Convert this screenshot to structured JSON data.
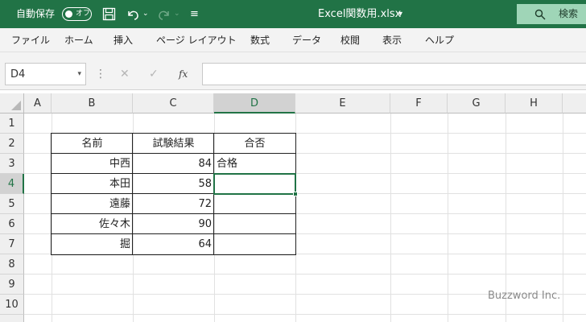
{
  "titlebar": {
    "autosave_label": "自動保存",
    "autosave_toggle": "オフ",
    "filename": "Excel関数用.xlsx",
    "filename_caret": "▾",
    "search_label": "検索",
    "customize": "≡"
  },
  "ribbon": {
    "tabs": [
      "ファイル",
      "ホーム",
      "挿入",
      "ページ レイアウト",
      "数式",
      "データ",
      "校閲",
      "表示",
      "ヘルプ"
    ]
  },
  "formula_bar": {
    "name_box": "D4",
    "name_caret": "▾",
    "dots": "⋮",
    "cancel": "✕",
    "enter": "✓",
    "fx": "fx",
    "formula": ""
  },
  "columns": [
    "A",
    "B",
    "C",
    "D",
    "E",
    "F",
    "G",
    "H"
  ],
  "selected_column": "D",
  "rows": [
    "1",
    "2",
    "3",
    "4",
    "5",
    "6",
    "7",
    "8",
    "9",
    "10"
  ],
  "selected_row": "4",
  "table": {
    "headers": [
      "名前",
      "試験結果",
      "合否"
    ],
    "rows": [
      {
        "name": "中西",
        "score": "84",
        "result": "合格"
      },
      {
        "name": "本田",
        "score": "58",
        "result": ""
      },
      {
        "name": "遠藤",
        "score": "72",
        "result": ""
      },
      {
        "name": "佐々木",
        "score": "90",
        "result": ""
      },
      {
        "name": "掘",
        "score": "64",
        "result": ""
      }
    ]
  },
  "watermark": "Buzzword Inc.",
  "colors": {
    "accent": "#217346",
    "search_bg": "#9fd5b7"
  }
}
